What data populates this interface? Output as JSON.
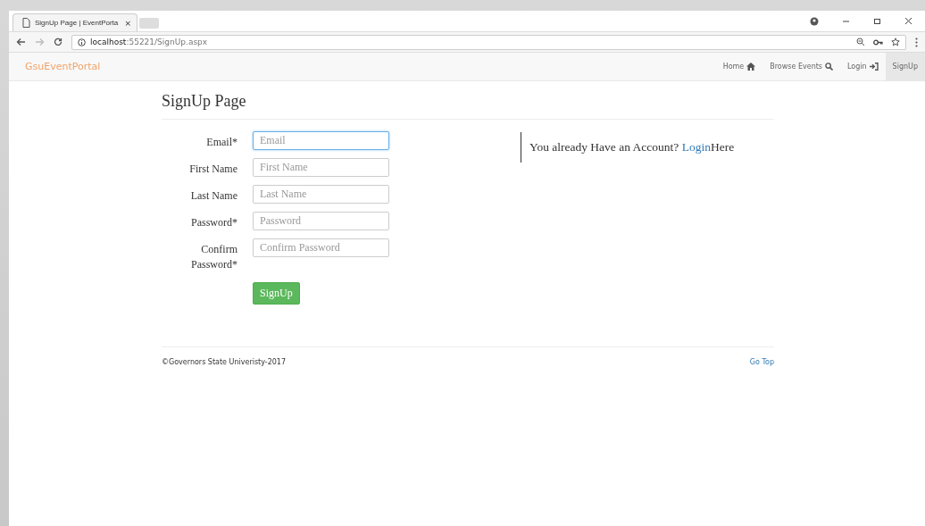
{
  "browser": {
    "tab_title": "SignUp Page | EventPorta",
    "tab_close": "×",
    "url_host": "localhost",
    "url_rest": ":55221/SignUp.aspx"
  },
  "navbar": {
    "brand": "GsuEventPortal",
    "items": [
      {
        "label": "Home",
        "kind": "home",
        "selected": false
      },
      {
        "label": "Browse Events",
        "kind": "search",
        "selected": false
      },
      {
        "label": "Login",
        "kind": "login",
        "selected": false
      },
      {
        "label": "SignUp",
        "kind": "plain",
        "selected": true
      }
    ]
  },
  "page": {
    "title": "SignUp Page",
    "fields": [
      {
        "label": "Email*",
        "placeholder": "Email",
        "focused": true
      },
      {
        "label": "First Name",
        "placeholder": "First Name",
        "focused": false
      },
      {
        "label": "Last Name",
        "placeholder": "Last Name",
        "focused": false
      },
      {
        "label": "Password*",
        "placeholder": "Password",
        "focused": false
      },
      {
        "label": "Confirm Password*",
        "placeholder": "Confirm Password",
        "focused": false
      }
    ],
    "submit": "SignUp",
    "aside": {
      "before": "You already Have an Account? ",
      "link": "Login",
      "after": "Here"
    }
  },
  "footer": {
    "copyright": "©Governors State Univeristy-2017",
    "go_top": "Go Top"
  }
}
